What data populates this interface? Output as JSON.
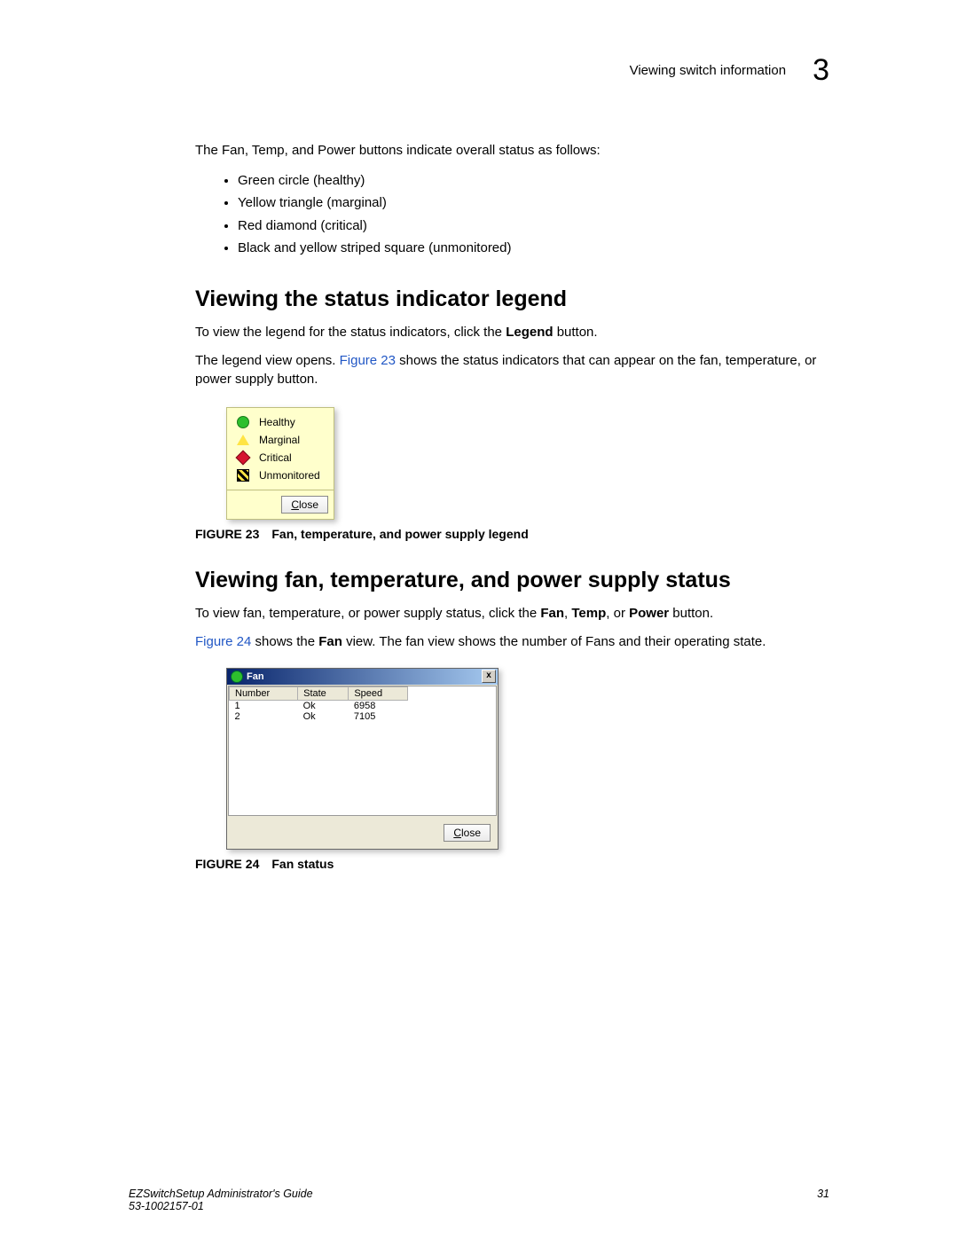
{
  "header": {
    "section_title": "Viewing switch information",
    "chapter_number": "3"
  },
  "intro_text": "The Fan, Temp, and Power buttons indicate overall status as follows:",
  "status_bullets": [
    "Green circle (healthy)",
    "Yellow triangle (marginal)",
    "Red diamond (critical)",
    "Black and yellow striped square (unmonitored)"
  ],
  "section1": {
    "heading": "Viewing the status indicator legend",
    "p1_a": "To view the legend for the status indicators, click the ",
    "p1_b_bold": "Legend",
    "p1_c": " button.",
    "p2_a": "The legend view opens. ",
    "p2_link": "Figure 23",
    "p2_b": " shows the status indicators that can appear on the fan, temperature, or power supply button."
  },
  "legend": {
    "rows": [
      {
        "label": "Healthy"
      },
      {
        "label": "Marginal"
      },
      {
        "label": "Critical"
      },
      {
        "label": "Unmonitored"
      }
    ],
    "close_u": "C",
    "close_rest": "lose"
  },
  "fig23": {
    "label": "FIGURE 23",
    "caption": "Fan, temperature, and power supply legend"
  },
  "section2": {
    "heading": "Viewing fan, temperature, and power supply status",
    "p1_a": "To view fan, temperature, or power supply status, click the ",
    "p1_fan": "Fan",
    "p1_sep1": ", ",
    "p1_temp": "Temp",
    "p1_sep2": ", or ",
    "p1_power": "Power",
    "p1_end": " button.",
    "p2_link": "Figure 24",
    "p2_a": " shows the ",
    "p2_bold": "Fan",
    "p2_b": " view. The fan view shows the number of Fans and their operating state."
  },
  "fan_dialog": {
    "title": "Fan",
    "close_x": "x",
    "headers": [
      "Number",
      "State",
      "Speed"
    ],
    "rows": [
      {
        "number": "1",
        "state": "Ok",
        "speed": "6958"
      },
      {
        "number": "2",
        "state": "Ok",
        "speed": "7105"
      }
    ],
    "close_u": "C",
    "close_rest": "lose"
  },
  "fig24": {
    "label": "FIGURE 24",
    "caption": "Fan status"
  },
  "footer": {
    "guide": "EZSwitchSetup Administrator's Guide",
    "docnum": "53-1002157-01",
    "page": "31"
  }
}
